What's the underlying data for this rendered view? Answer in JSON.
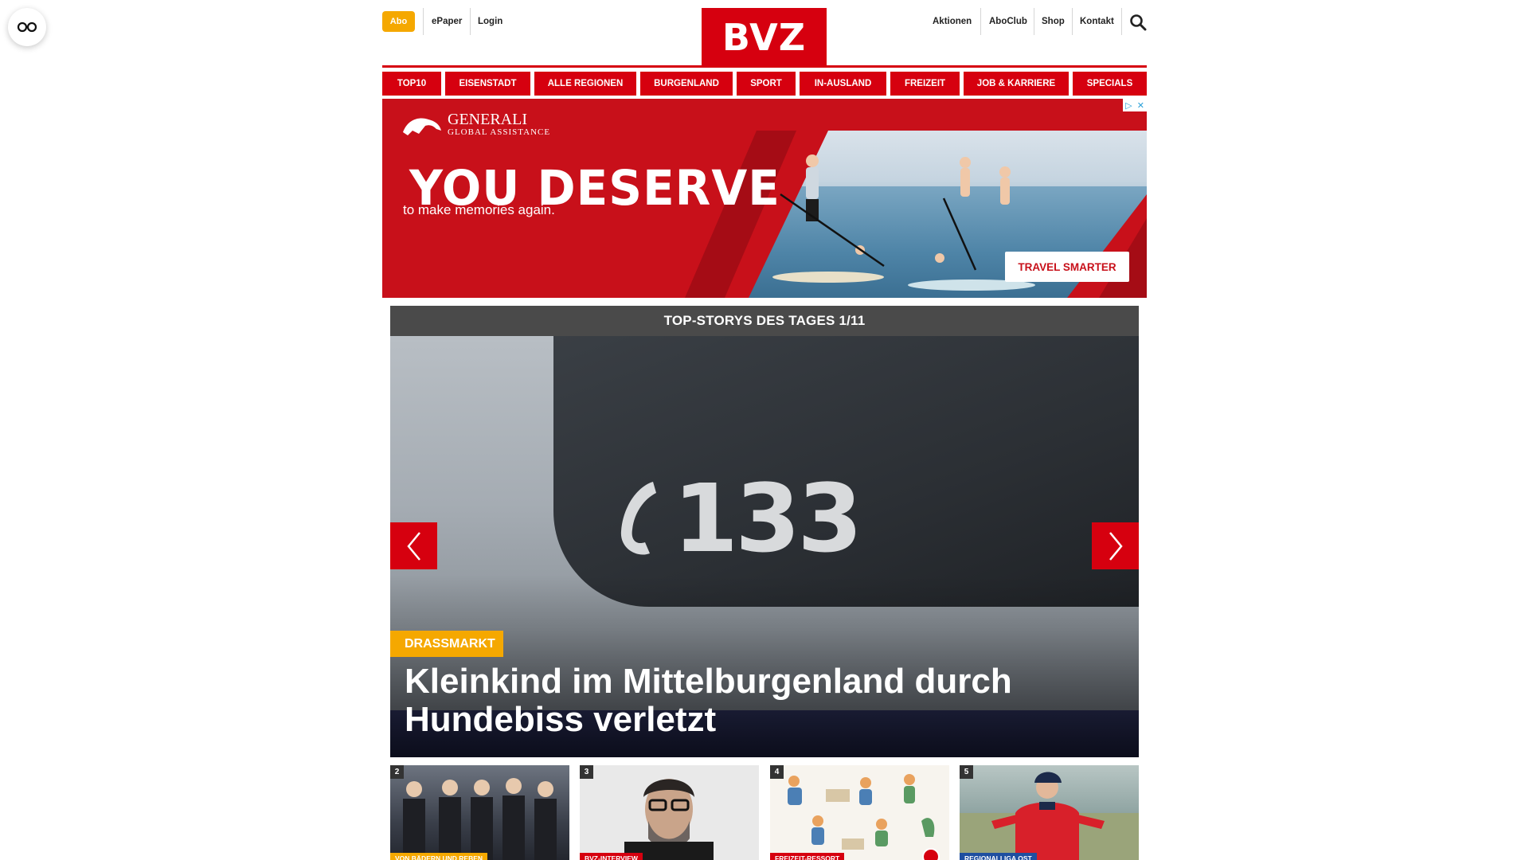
{
  "header": {
    "abo_label": "Abo",
    "left_links": [
      "ePaper",
      "Login"
    ],
    "logo_text": "BVZ",
    "right_links": [
      "Aktionen",
      "AboClub",
      "Shop",
      "Kontakt"
    ]
  },
  "nav": {
    "items": [
      "TOP10",
      "EISENSTADT",
      "ALLE REGIONEN",
      "BURGENLAND",
      "SPORT",
      "IN-AUSLAND",
      "FREIZEIT",
      "JOB & KARRIERE",
      "SPECIALS"
    ]
  },
  "ad": {
    "brand_line1": "GENERALI",
    "brand_line2": "GLOBAL ASSISTANCE",
    "headline": "YOU DESERVE",
    "subline": "to make memories again.",
    "cta": "TRAVEL SMARTER",
    "choice_icons": [
      "ad-choices-icon",
      "close-icon"
    ]
  },
  "top_stories": {
    "bar_title": "TOP-STORYS DES TAGES 1/11",
    "hero": {
      "tag": "DRASSMARKT",
      "headline": "Kleinkind im Mittelburgenland durch Hundebiss verletzt",
      "image_text": "133"
    },
    "thumbs": [
      {
        "num": "2",
        "tag": "VON BÄDERN UND REBEN",
        "tag_color": "#f5a800"
      },
      {
        "num": "3",
        "tag": "BVZ-INTERVIEW",
        "tag_color": "#d6000f"
      },
      {
        "num": "4",
        "tag": "FREIZEIT-RESSORT",
        "tag_color": "#d6000f"
      },
      {
        "num": "5",
        "tag": "REGIONALLIGA OST",
        "tag_color": "#1f4fa0"
      }
    ]
  },
  "colors": {
    "brand_red": "#d6000f",
    "abo_yellow": "#f5a800",
    "stories_bar": "#4a4a4a"
  }
}
